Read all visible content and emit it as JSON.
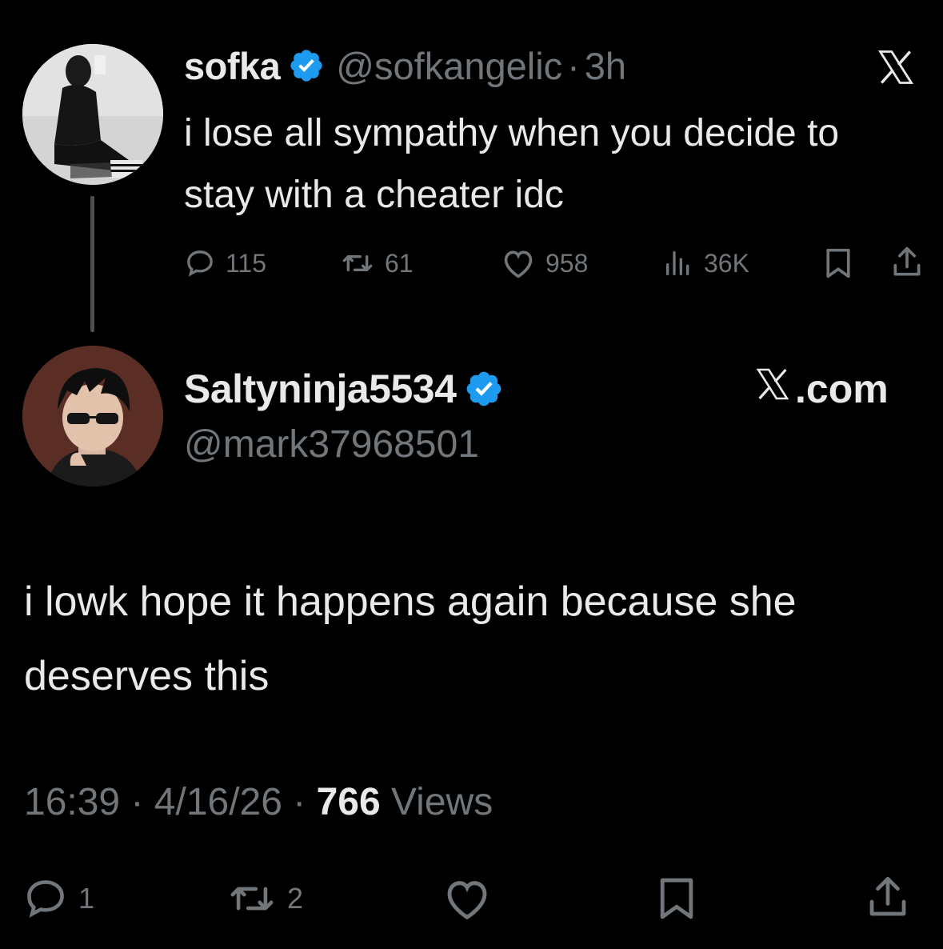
{
  "colors": {
    "background": "#000000",
    "primary_text": "#e7e9ea",
    "secondary_text": "#71767b",
    "verified_blue": "#1d9bf0",
    "thread_line": "#4a4f54"
  },
  "parent_tweet": {
    "author_name": "sofka",
    "verified_icon": "verified-badge-icon",
    "handle": "@sofkangelic",
    "separator": "·",
    "time": "3h",
    "brand_icon": "x-logo-icon",
    "text": "i lose all sympathy when you decide to stay with a cheater idc",
    "stats": {
      "replies": "115",
      "reposts": "61",
      "likes": "958",
      "views": "36K"
    }
  },
  "reply_tweet": {
    "author_name": "Saltyninja5534",
    "verified_icon": "verified-badge-icon",
    "handle": "@mark37968501",
    "brand_label": ".com",
    "brand_icon": "x-logo-icon",
    "text": "i lowk hope it happens again because she deserves this",
    "meta": {
      "time": "16:39",
      "sep1": " · ",
      "date": "4/16/26",
      "sep2": " · ",
      "views_count": "766",
      "views_label": " Views"
    },
    "stats": {
      "replies": "1",
      "reposts": "2"
    }
  }
}
